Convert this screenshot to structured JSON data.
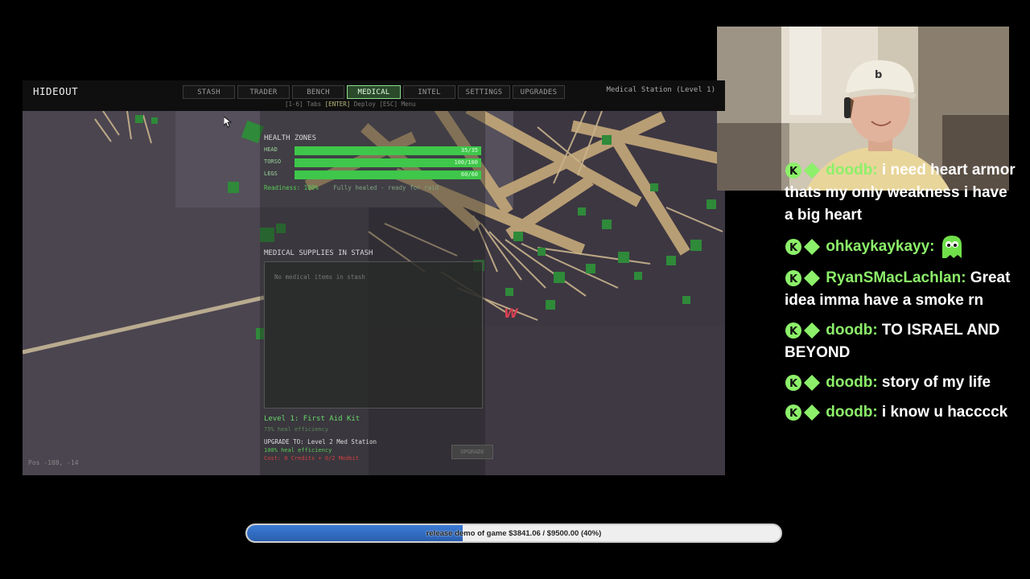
{
  "game": {
    "title": "HIDEOUT",
    "tabs": [
      {
        "label": "STASH",
        "active": false
      },
      {
        "label": "TRADER",
        "active": false
      },
      {
        "label": "BENCH",
        "active": false
      },
      {
        "label": "MEDICAL",
        "active": true
      },
      {
        "label": "INTEL",
        "active": false
      },
      {
        "label": "SETTINGS",
        "active": false
      },
      {
        "label": "UPGRADES",
        "active": false
      }
    ],
    "hints": {
      "tabs_key": "[1-6]",
      "tabs_label": "Tabs",
      "deploy_key": "[ENTER]",
      "deploy_label": "Deploy",
      "menu_key": "[ESC]",
      "menu_label": "Menu"
    },
    "station_level": "Medical Station (Level 1)",
    "health_zones": {
      "title": "HEALTH ZONES",
      "zones": [
        {
          "label": "HEAD",
          "value": "35/35",
          "fraction": 1.0
        },
        {
          "label": "TORSO",
          "value": "100/100",
          "fraction": 1.0
        },
        {
          "label": "LEGS",
          "value": "60/60",
          "fraction": 1.0
        }
      ]
    },
    "readiness": {
      "label": "Readiness: 100%",
      "note": "Fully healed - ready for raid"
    },
    "supplies": {
      "title": "MEDICAL SUPPLIES IN STASH",
      "empty_text": "No medical items in stash"
    },
    "current_level": {
      "title": "Level 1: First Aid Kit",
      "efficiency": "75% heal efficiency"
    },
    "upgrade": {
      "title": "UPGRADE TO: Level 2 Med Station",
      "efficiency": "100% heal efficiency",
      "cost": "Cost: 0 Credits + 0/2 Medkit",
      "button_label": "UPGRADE"
    },
    "position_readout": "Pos -108, -14",
    "colors": {
      "accent_green": "#3ec74a",
      "cost_red": "#d04040"
    }
  },
  "chat": {
    "messages": [
      {
        "user": "doodb",
        "text": "i need heart armor thats my only weakness i have a big heart"
      },
      {
        "user": "ohkaykaykayy",
        "text": "",
        "emote": "green-ghost-emote"
      },
      {
        "user": "RyanSMacLachlan",
        "text": "Great idea imma have a smoke rn"
      },
      {
        "user": "doodb",
        "text": "TO ISRAEL AND BEYOND"
      },
      {
        "user": "doodb",
        "text": "story of my life"
      },
      {
        "user": "doodb",
        "text": "i know u hacccck"
      }
    ],
    "username_color": "#8cf06a"
  },
  "goal": {
    "text": "release demo of game $3841.06 / $9500.00 (40%)",
    "progress_fraction": 0.404
  }
}
